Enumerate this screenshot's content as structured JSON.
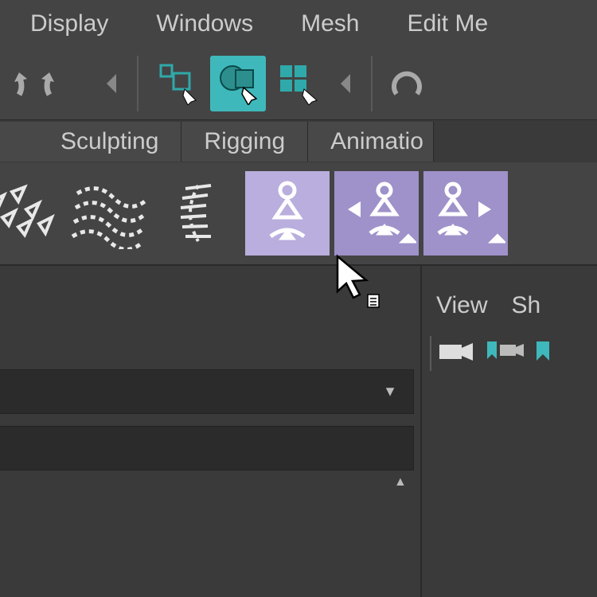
{
  "menu": {
    "display": "Display",
    "windows": "Windows",
    "mesh": "Mesh",
    "edit_mesh": "Edit Me"
  },
  "toolbar": {
    "undo": "undo-icon",
    "redo": "redo-icon",
    "select_rect": "select-rect-icon",
    "select_circle": "select-circle-icon",
    "select_grid": "select-grid-icon"
  },
  "shelf": {
    "tabs": {
      "sculpting": "Sculpting",
      "rigging": "Rigging",
      "animation": "Animatio"
    }
  },
  "panel": {
    "menu": {
      "view": "View",
      "shading": "Sh"
    }
  }
}
